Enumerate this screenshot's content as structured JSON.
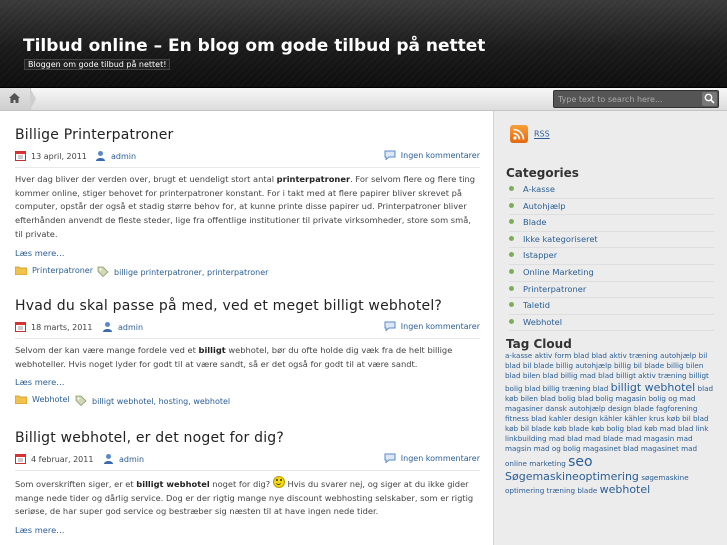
{
  "site": {
    "title": "Tilbud online – En blog om gode tilbud på nettet",
    "description": "Bloggen om gode tilbud på nettet!"
  },
  "search": {
    "placeholder": "Type text to search here..."
  },
  "posts": [
    {
      "title": "Billige Printerpatroner",
      "date": "13 april, 2011",
      "author": "admin",
      "comments": "Ingen kommentarer",
      "excerpt": [
        "Hver dag bliver der verden over, brugt et uendeligt stort antal ",
        "printerpatroner",
        ". For selvom flere og flere ting kommer online, stiger behovet for printerpatroner konstant. For i takt med at flere papirer bliver skrevet på computer, opstår der også et stadig større behov for, at kunne printe disse papirer ud. Printerpatroner bliver efterhånden anvendt de fleste steder, lige fra offentlige institutioner til private virksomheder, store som små, til private."
      ],
      "more": "Læs mere…",
      "category": "Printerpatroner",
      "tags": "billige printerpatroner, printerpatroner"
    },
    {
      "title": "Hvad du skal passe på med, ved et meget billigt webhotel?",
      "date": "18 marts, 2011",
      "author": "admin",
      "comments": "Ingen kommentarer",
      "excerpt": [
        "Selvom der kan være mange fordele ved et ",
        "billigt",
        " webhotel, bør du ofte holde dig væk fra de helt billige webhoteller. Hvis noget lyder for godt til at være sandt, så er det også for godt til at være sandt."
      ],
      "more": "Læs mere…",
      "category": "Webhotel",
      "tags": "billigt webhotel, hosting, webhotel"
    },
    {
      "title": "Billigt webhotel, er det noget for dig?",
      "date": "4 februar, 2011",
      "author": "admin",
      "comments": "Ingen kommentarer",
      "excerpt": [
        "Som overskriften siger, er et ",
        "billigt webhotel",
        " noget for dig? ",
        " Hvis du svarer nej, og siger at du ikke gider mange nede tider og dårlig service. Dog er der rigtig mange nye discount webhosting selskaber, som er rigtig seriøse, de har super god service og bestræber sig næsten til at have ingen nede tider."
      ],
      "more": "Læs mere…"
    }
  ],
  "sidebar": {
    "rss": "RSS",
    "categories_title": "Categories",
    "categories": [
      "A-kasse",
      "Autohjælp",
      "Blade",
      "Ikke kategoriseret",
      "Istapper",
      "Online Marketing",
      "Printerpatroner",
      "Taletid",
      "Webhotel"
    ],
    "tagcloud_title": "Tag Cloud",
    "tags": [
      {
        "t": "a-kasse",
        "s": "s"
      },
      {
        "t": "aktiv form blad",
        "s": "s"
      },
      {
        "t": "blad aktiv træning",
        "s": "s"
      },
      {
        "t": "autohjælp",
        "s": "s"
      },
      {
        "t": "bil blad",
        "s": "s"
      },
      {
        "t": "bil blade",
        "s": "s"
      },
      {
        "t": "billig autohjælp",
        "s": "s"
      },
      {
        "t": "billig bil blade",
        "s": "s"
      },
      {
        "t": "billig bilen blad",
        "s": "s"
      },
      {
        "t": "bilen blad",
        "s": "s"
      },
      {
        "t": "billig mad blad",
        "s": "s"
      },
      {
        "t": "billigt aktiv træning",
        "s": "s"
      },
      {
        "t": "billigt bolig blad",
        "s": "s"
      },
      {
        "t": "billig træning blad",
        "s": "s"
      },
      {
        "t": "billigt webhotel",
        "s": "b"
      },
      {
        "t": "blad køb bilen",
        "s": "s"
      },
      {
        "t": "blad bolig",
        "s": "s"
      },
      {
        "t": "blad bolig magasin",
        "s": "s"
      },
      {
        "t": "bolig og mad magasiner",
        "s": "s"
      },
      {
        "t": "dansk autohjælp",
        "s": "s"
      },
      {
        "t": "design blade",
        "s": "s"
      },
      {
        "t": "fagforening",
        "s": "s"
      },
      {
        "t": "fitness blad",
        "s": "s"
      },
      {
        "t": "kahler design",
        "s": "s"
      },
      {
        "t": "kähler",
        "s": "s"
      },
      {
        "t": "kähler krus",
        "s": "s"
      },
      {
        "t": "køb bil blad",
        "s": "s"
      },
      {
        "t": "køb bil",
        "s": "s"
      },
      {
        "t": "blade",
        "s": "s"
      },
      {
        "t": "køb blade",
        "s": "s"
      },
      {
        "t": "køb bolig blad",
        "s": "s"
      },
      {
        "t": "køb mad blad",
        "s": "s"
      },
      {
        "t": "link",
        "s": "s"
      },
      {
        "t": "linkbuilding",
        "s": "s"
      },
      {
        "t": "mad blad",
        "s": "s"
      },
      {
        "t": "mad blade",
        "s": "s"
      },
      {
        "t": "mad magasin",
        "s": "s"
      },
      {
        "t": "mad",
        "s": "s"
      },
      {
        "t": "magsin",
        "s": "s"
      },
      {
        "t": "mad og bolig magasinet",
        "s": "s"
      },
      {
        "t": "blad magasinet",
        "s": "s"
      },
      {
        "t": "mad",
        "s": "s"
      },
      {
        "t": "online marketing",
        "s": "s"
      },
      {
        "t": "seo",
        "s": "h"
      },
      {
        "t": "Søgemaskineoptimering",
        "s": "b"
      },
      {
        "t": "søgemaskine",
        "s": "s"
      },
      {
        "t": "optimering",
        "s": "s"
      },
      {
        "t": "træning blade",
        "s": "s"
      },
      {
        "t": "webhotel",
        "s": "b"
      }
    ]
  },
  "colors": {
    "link": "#2a5e94",
    "header": "#1b1b1b",
    "bullet": "#7cae5a",
    "rss": "#f07d1e"
  },
  "icons": {
    "home": "home-icon",
    "search": "magnifier-icon",
    "date": "calendar-icon",
    "author": "user-icon",
    "comments": "comment-icon",
    "category": "folder-icon",
    "tags": "tag-icon",
    "rss": "rss-icon",
    "smiley": "smiley-icon"
  }
}
